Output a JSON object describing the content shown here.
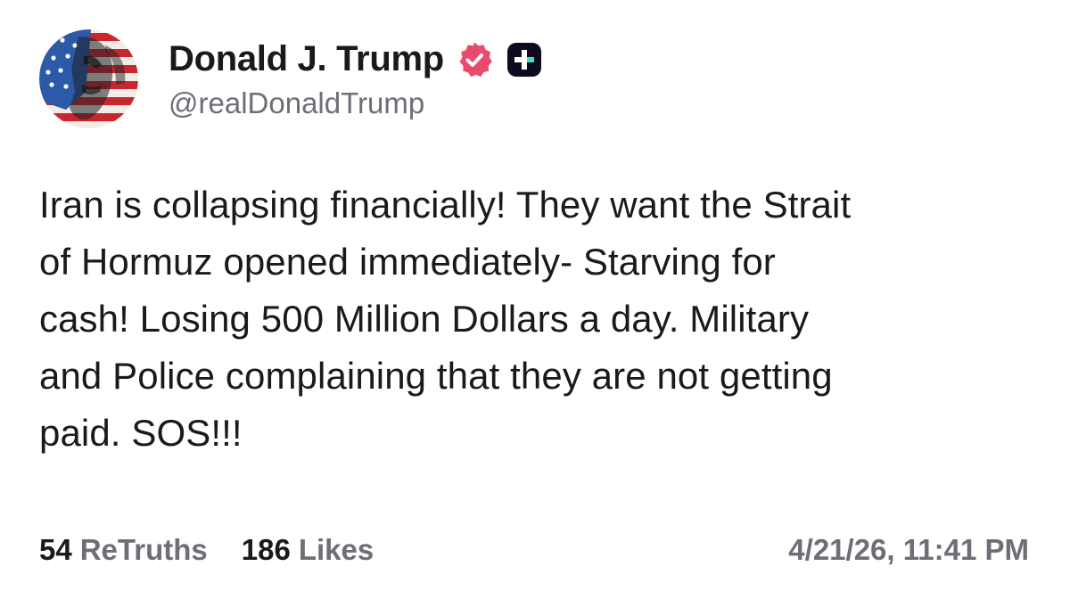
{
  "post": {
    "author": {
      "display_name": "Donald J. Trump",
      "handle": "@realDonaldTrump",
      "avatar_icon": "flag-face-avatar",
      "verified_icon": "verified-badge-icon",
      "plus_icon": "truth-plus-icon"
    },
    "text_lines": [
      "Iran is collapsing financially! They want the Strait",
      "of Hormuz opened immediately- Starving for",
      "cash! Losing 500 Million Dollars a day. Military",
      "and Police complaining that they are not getting",
      "paid. SOS!!!"
    ],
    "stats": {
      "retruths_count": "54",
      "retruths_label": "ReTruths",
      "likes_count": "186",
      "likes_label": "Likes"
    },
    "timestamp": "4/21/26, 11:41 PM"
  },
  "colors": {
    "text_primary": "#1a1a1a",
    "text_secondary": "#6e6e76",
    "verified_badge": "#e84c6c",
    "plus_badge_bg": "#0c0c1e",
    "plus_badge_accent": "#3de0c0",
    "background": "#ffffff"
  }
}
